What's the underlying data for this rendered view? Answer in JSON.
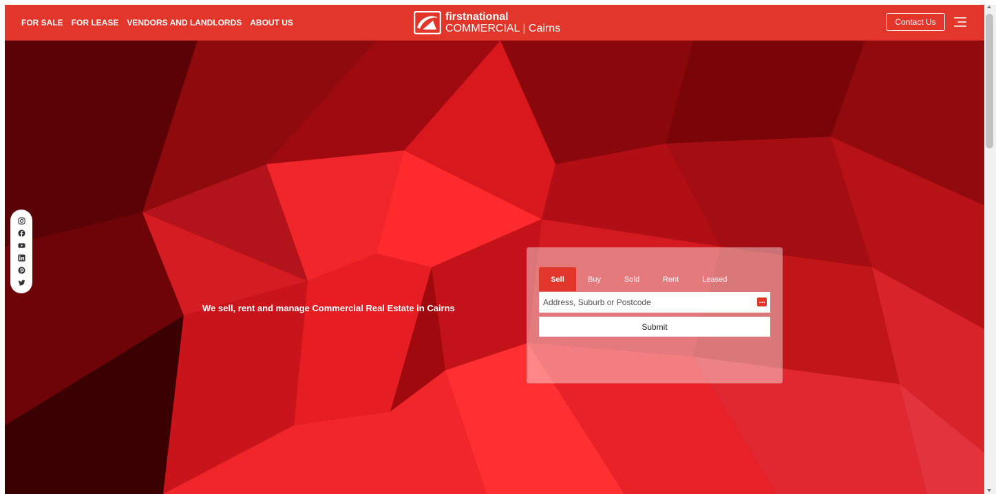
{
  "nav": {
    "links": [
      "FOR SALE",
      "FOR LEASE",
      "VENDORS AND LANDLORDS",
      "ABOUT US"
    ],
    "contact_label": "Contact Us",
    "menu_icon": "hamburger-menu-icon"
  },
  "logo": {
    "line1": "firstnational",
    "line2": "COMMERCIAL",
    "separator": "|",
    "city": "Cairns"
  },
  "social": {
    "icons": [
      "instagram-icon",
      "facebook-icon",
      "youtube-icon",
      "linkedin-icon",
      "pinterest-icon",
      "twitter-icon"
    ]
  },
  "hero": {
    "tagline": "We sell, rent and manage Commercial Real Estate in Cairns"
  },
  "search": {
    "tabs": [
      "Sell",
      "Buy",
      "Sold",
      "Rent",
      "Leased"
    ],
    "active_tab": "Sell",
    "placeholder": "Address, Suburb or Postcode",
    "value": "",
    "submit_label": "Submit",
    "input_icon": "more-dots-icon"
  },
  "colors": {
    "brand_red": "#e2362b",
    "hero_dark": "#6b0306",
    "hero_bright": "#ff1a1a"
  }
}
